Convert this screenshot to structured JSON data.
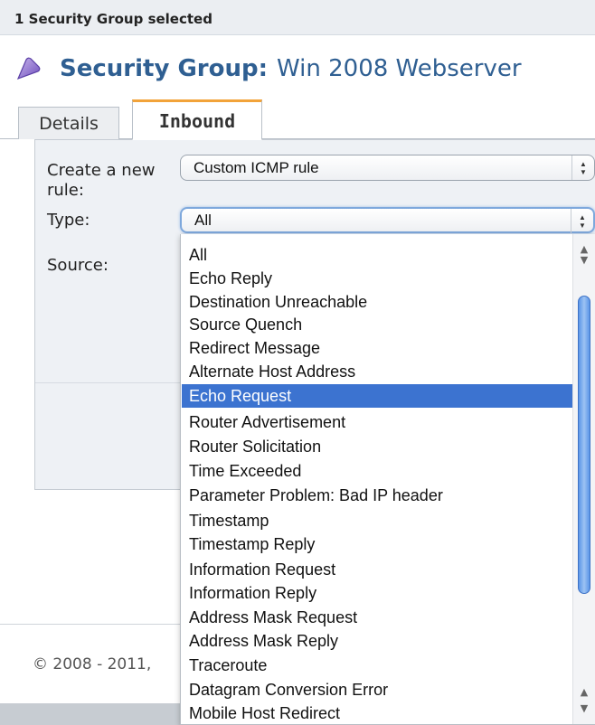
{
  "topbar": {
    "selection_text": "1 Security Group selected"
  },
  "title": {
    "label": "Security Group:",
    "value": "Win 2008 Webserver",
    "icon": "security-group-icon"
  },
  "tabs": [
    {
      "label": "Details",
      "active": false
    },
    {
      "label": "Inbound",
      "active": true
    }
  ],
  "form": {
    "create_rule_label": "Create a new rule:",
    "create_rule_value": "Custom ICMP rule",
    "type_label": "Type:",
    "type_value": "All",
    "source_label": "Source:"
  },
  "type_options": [
    "All",
    "Echo Reply",
    "Destination Unreachable",
    "Source Quench",
    "Redirect Message",
    "Alternate Host Address",
    "Echo Request",
    "Router Advertisement",
    "Router Solicitation",
    "Time Exceeded",
    "Parameter Problem: Bad IP header",
    "Timestamp",
    "Timestamp Reply",
    "Information Request",
    "Information Reply",
    "Address Mask Request",
    "Address Mask Reply",
    "Traceroute",
    "Datagram Conversion Error",
    "Mobile Host Redirect"
  ],
  "highlighted_option": "Echo Request",
  "footer": {
    "copyright": "© 2008 - 2011,"
  },
  "colors": {
    "accent": "#2f5f92",
    "tab_active_border": "#f2a33a",
    "selection": "#3c73d0"
  }
}
